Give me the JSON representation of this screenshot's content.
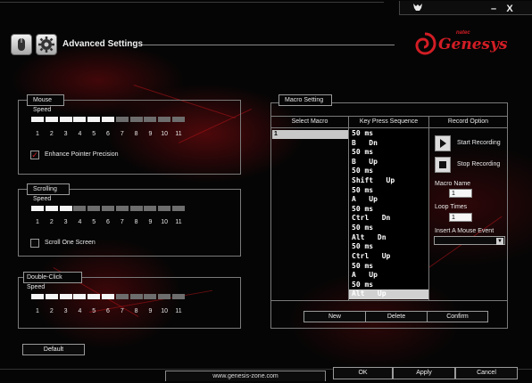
{
  "window": {
    "controls": {
      "minimize": "–",
      "close": "X"
    },
    "title": "Advanced Settings"
  },
  "brand": {
    "maker": "natec",
    "product": "Genesys",
    "color": "#d21d25"
  },
  "mouse_speed": {
    "label": "Mouse Speed",
    "level": 6,
    "max": 11,
    "ticks": [
      "1",
      "2",
      "3",
      "4",
      "5",
      "6",
      "7",
      "8",
      "9",
      "10",
      "11"
    ],
    "option_label": "Enhance Pointer Precision",
    "option_checked": true
  },
  "scrolling_speed": {
    "label": "Scrolling Speed",
    "level": 3,
    "max": 11,
    "ticks": [
      "1",
      "2",
      "3",
      "4",
      "5",
      "6",
      "7",
      "8",
      "9",
      "10",
      "11"
    ],
    "option_label": "Scroll One Screen",
    "option_checked": false
  },
  "double_click_speed": {
    "label": "Double-Click Speed",
    "level": 6,
    "max": 11,
    "ticks": [
      "1",
      "2",
      "3",
      "4",
      "5",
      "6",
      "7",
      "8",
      "9",
      "10",
      "11"
    ]
  },
  "default_button": "Default",
  "macro": {
    "group_label": "Macro Setting",
    "col_select": "Select Macro",
    "col_sequence": "Key Press Sequence",
    "col_record": "Record Option",
    "macros": [
      "1"
    ],
    "sequence": [
      "50 ms",
      "B   Dn",
      "50 ms",
      "B   Up",
      "50 ms",
      "Shift   Up",
      "50 ms",
      "A   Up",
      "50 ms",
      "Ctrl   Dn",
      "50 ms",
      "Alt   Dn",
      "50 ms",
      "Ctrl   Up",
      "50 ms",
      "A   Up",
      "50 ms",
      "Alt   Up"
    ],
    "selected_index": 17,
    "start_recording": "Start Recording",
    "stop_recording": "Stop Recording",
    "macro_name_label": "Macro Name",
    "macro_name_value": "1",
    "loop_times_label": "Loop Times",
    "loop_times_value": "1",
    "insert_event_label": "Insert A Mouse Event",
    "insert_event_value": "",
    "buttons": {
      "new": "New",
      "delete": "Delete",
      "confirm": "Confirm"
    }
  },
  "footer": {
    "url": "www.genesis-zone.com",
    "ok": "OK",
    "apply": "Apply",
    "cancel": "Cancel"
  }
}
